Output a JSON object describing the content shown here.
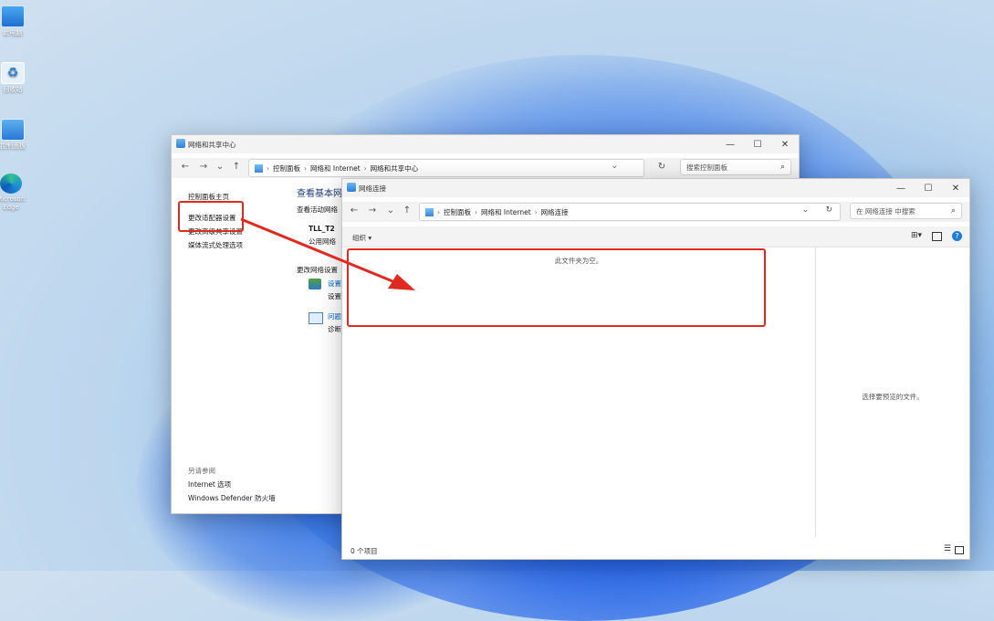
{
  "desktop": {
    "icons": [
      {
        "label": "此电脑"
      },
      {
        "label": "回收站"
      },
      {
        "label": "控制面板"
      },
      {
        "label": "Microsoft Edge"
      }
    ]
  },
  "net_center": {
    "title": "网络和共享中心",
    "breadcrumb": [
      "控制面板",
      "网络和 Internet",
      "网络和共享中心"
    ],
    "search_placeholder": "搜索控制面板",
    "sidebar": {
      "home": "控制面板主页",
      "change_adapter": "更改适配器设置",
      "change_sharing": "更改高级共享设置",
      "media_streaming": "媒体流式处理选项",
      "see_also": "另请参阅",
      "internet_options": "Internet 选项",
      "defender_firewall": "Windows Defender 防火墙"
    },
    "main": {
      "heading": "查看基本网",
      "active_networks": "查看活动网络",
      "network_name": "TLL_T2",
      "network_type": "公用网络",
      "change_settings": "更改网络设置",
      "setup_link": "设置",
      "setup_desc": "设置",
      "trouble_link": "问题",
      "trouble_desc": "诊断"
    }
  },
  "net_connections": {
    "title": "网络连接",
    "breadcrumb": [
      "控制面板",
      "网络和 Internet",
      "网络连接"
    ],
    "search_placeholder": "在 网络连接 中搜索",
    "organize": "组织 ▾",
    "empty_text": "此文件夹为空。",
    "preview_text": "选择要预览的文件。",
    "status": "0 个项目"
  },
  "colors": {
    "highlight_red": "#e02a20",
    "link_blue": "#0066cc"
  }
}
